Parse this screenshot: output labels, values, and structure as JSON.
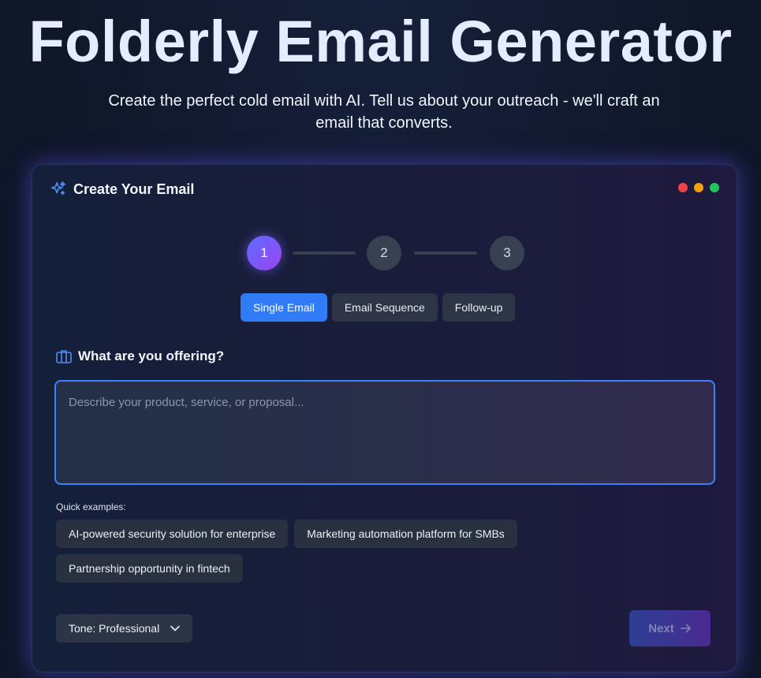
{
  "hero": {
    "title": "Folderly Email Generator",
    "subtitle": "Create the perfect cold email with AI. Tell us about your outreach - we'll craft an email that converts."
  },
  "card": {
    "title": "Create Your Email",
    "icon": "sparkles-icon",
    "window_dots": [
      "#ef4444",
      "#f59e0b",
      "#22c55e"
    ]
  },
  "stepper": {
    "steps": [
      "1",
      "2",
      "3"
    ],
    "active_step": 1
  },
  "mode_tabs": {
    "items": [
      "Single Email",
      "Email Sequence",
      "Follow-up"
    ],
    "active": "Single Email"
  },
  "offering": {
    "label": "What are you offering?",
    "icon": "briefcase-icon",
    "placeholder": "Describe your product, service, or proposal...",
    "value": ""
  },
  "examples": {
    "label": "Quick examples:",
    "items": [
      "AI-powered security solution for enterprise",
      "Marketing automation platform for SMBs",
      "Partnership opportunity in fintech"
    ]
  },
  "tone": {
    "label": "Tone: Professional",
    "icon": "chevron-down-icon"
  },
  "next_button": {
    "label": "Next",
    "icon": "arrow-right-icon"
  },
  "colors": {
    "accent": "#2f7cf6",
    "step_active_gradient": [
      "#5b6cff",
      "#9b45f0"
    ],
    "background": "#0f1729"
  }
}
